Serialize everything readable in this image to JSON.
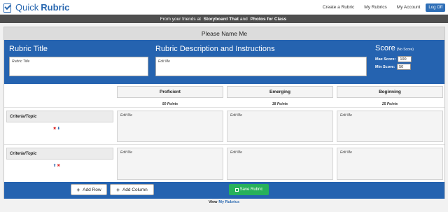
{
  "app": {
    "logo_quick": "Quick",
    "logo_rubric": "Rubric"
  },
  "nav": {
    "create": "Create a Rubric",
    "my_rubrics": "My Rubrics",
    "my_account": "My Account",
    "log_off": "Log Off"
  },
  "banner": {
    "prefix": "From your friends at",
    "brand1": "Storyboard That",
    "and": "and",
    "brand2": "Photos for Class"
  },
  "rubric": {
    "name": "Please Name Me",
    "title_heading": "Rubric Title",
    "title_value": "Rubric Title",
    "desc_heading": "Rubric Description and Instructions",
    "desc_value": "Edit Me",
    "score_heading": "Score",
    "score_sub": "(No Score)",
    "max_label": "Max Score:",
    "max_value": "100",
    "min_label": "Min Score:",
    "min_value": "50"
  },
  "columns": [
    {
      "label": "Proficient",
      "points": "50 Points"
    },
    {
      "label": "Emerging",
      "points": "38 Points"
    },
    {
      "label": "Beginning",
      "points": "25 Points"
    }
  ],
  "criteria": [
    {
      "label": "Criteria/Topic",
      "cells": [
        "Edit Me",
        "Edit Me",
        "Edit Me"
      ]
    },
    {
      "label": "Criteria/Topic",
      "cells": [
        "Edit Me",
        "Edit Me",
        "Edit Me"
      ]
    }
  ],
  "footer": {
    "add_row": "Add Row",
    "add_column": "Add Column",
    "save": "Save Rubric",
    "view_prefix": "View",
    "view_link": "My Rubrics"
  },
  "colors": {
    "accent_blue": "#2563b0",
    "save_green": "#27b15b",
    "delete_red": "#dd2222"
  }
}
